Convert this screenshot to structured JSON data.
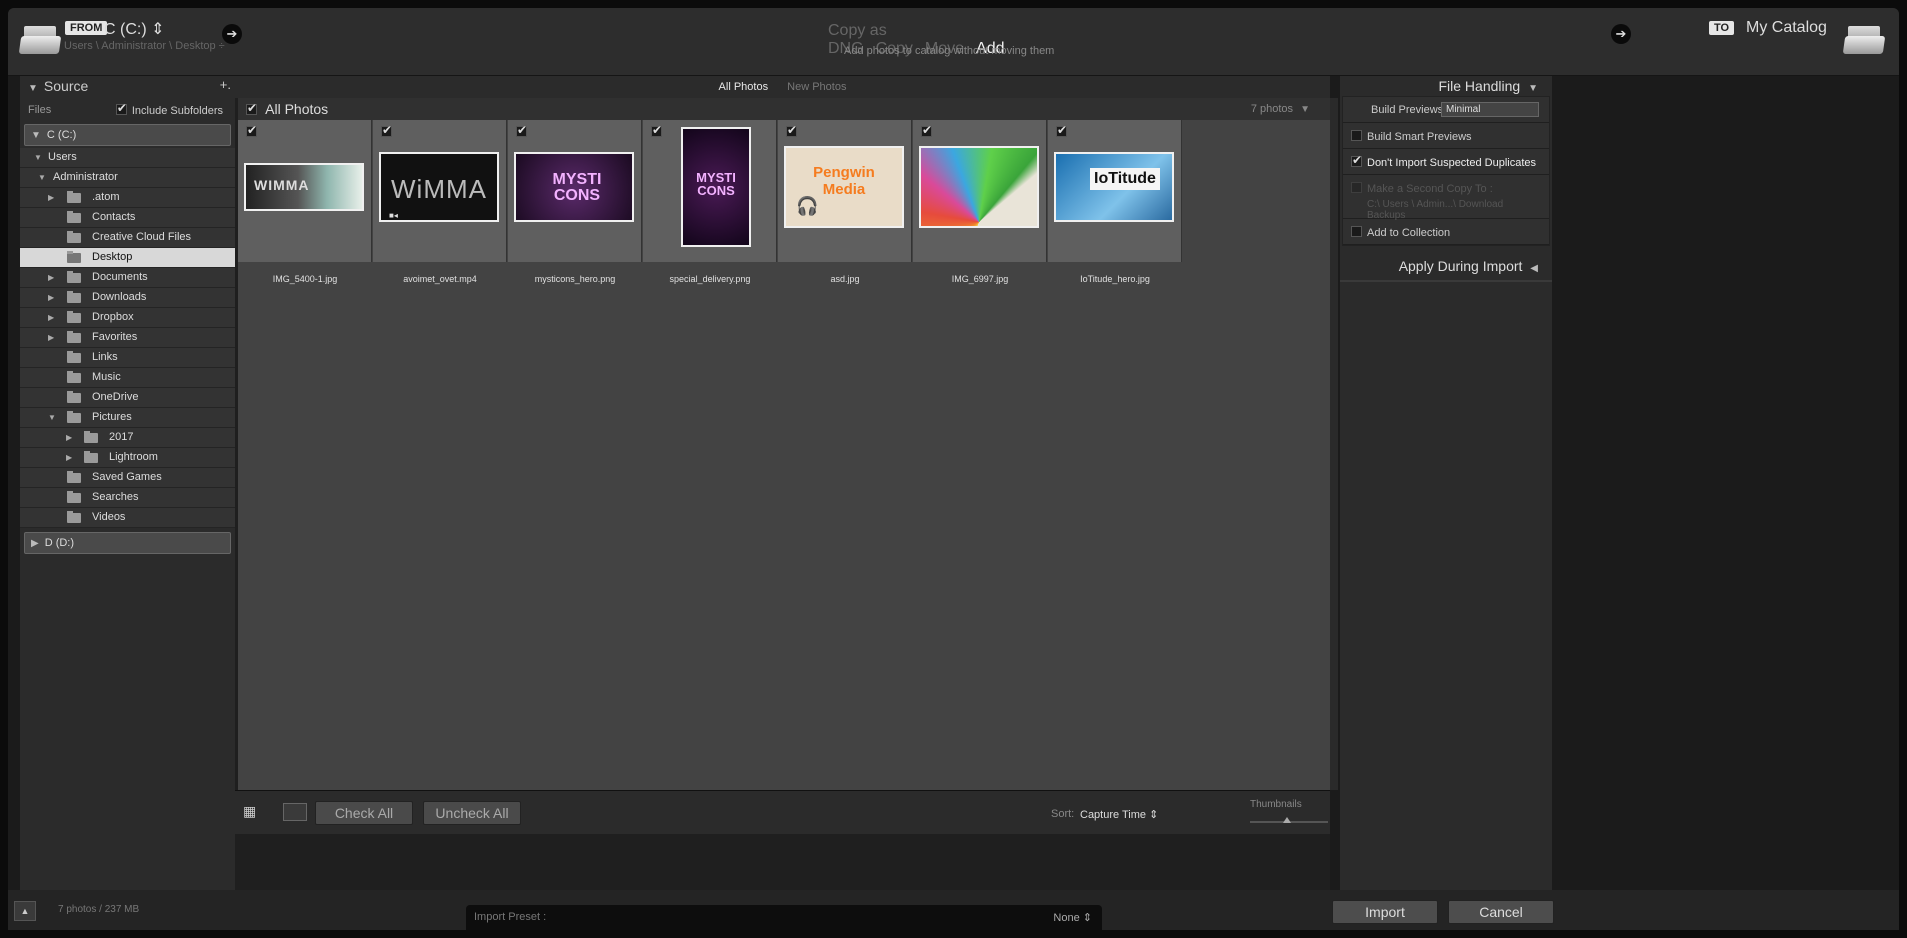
{
  "header": {
    "from_tag": "FROM",
    "source_name": "C (C:) ⇕",
    "source_path": "Users \\ Administrator \\ Desktop ÷",
    "modes": [
      "Copy as DNG",
      "Copy",
      "Move",
      "Add"
    ],
    "active_mode": "Add",
    "mode_description": "Add photos to catalog without moving them",
    "to_tag": "TO",
    "destination": "My Catalog",
    "arrow": "➔"
  },
  "source_panel": {
    "title": "Source",
    "add": "+.",
    "files_label": "Files",
    "include_subfolders": "Include Subfolders",
    "volume_c": "C (C:)",
    "volume_d": "D (D:)",
    "tree": [
      {
        "label": "Users"
      },
      {
        "label": "Administrator"
      },
      {
        "label": ".atom"
      },
      {
        "label": "Contacts"
      },
      {
        "label": "Creative Cloud Files"
      },
      {
        "label": "Desktop"
      },
      {
        "label": "Documents"
      },
      {
        "label": "Downloads"
      },
      {
        "label": "Dropbox"
      },
      {
        "label": "Favorites"
      },
      {
        "label": "Links"
      },
      {
        "label": "Music"
      },
      {
        "label": "OneDrive"
      },
      {
        "label": "Pictures"
      },
      {
        "label": "2017"
      },
      {
        "label": "Lightroom"
      },
      {
        "label": "Saved Games"
      },
      {
        "label": "Searches"
      },
      {
        "label": "Videos"
      }
    ]
  },
  "center": {
    "tabs": [
      "All Photos",
      "New Photos"
    ],
    "active_tab": "All Photos",
    "section_title": "All Photos",
    "count": "7 photos",
    "photos": [
      {
        "name": "IMG_5400-1.jpg",
        "text": "WIMMA"
      },
      {
        "name": "avoimet_ovet.mp4",
        "text": "WiMMA"
      },
      {
        "name": "mysticons_hero.png",
        "text": "MYSTI CONS"
      },
      {
        "name": "special_delivery.png",
        "text": "MYSTI CONS"
      },
      {
        "name": "asd.jpg",
        "text": "Pengwin Media"
      },
      {
        "name": "IMG_6997.jpg",
        "text": ""
      },
      {
        "name": "IoTitude_hero.jpg",
        "text": "IoTitude"
      }
    ],
    "check_all": "Check All",
    "uncheck_all": "Uncheck All",
    "sort_label": "Sort:",
    "sort_value": "Capture Time ⇕",
    "thumbnails_label": "Thumbnails"
  },
  "file_handling": {
    "title": "File Handling",
    "build_previews_label": "Build Previews",
    "build_previews_value": "Minimal",
    "smart_previews": "Build Smart Previews",
    "no_duplicates": "Don't Import Suspected Duplicates",
    "second_copy": "Make a Second Copy To :",
    "second_copy_path": "C:\\ Users \\ Admin...\\ Download Backups",
    "add_collection": "Add to Collection",
    "apply_during_import": "Apply During Import"
  },
  "footer": {
    "summary": "7 photos / 237 MB",
    "preset_label": "Import Preset :",
    "preset_value": "None ⇕",
    "import": "Import",
    "cancel": "Cancel"
  }
}
